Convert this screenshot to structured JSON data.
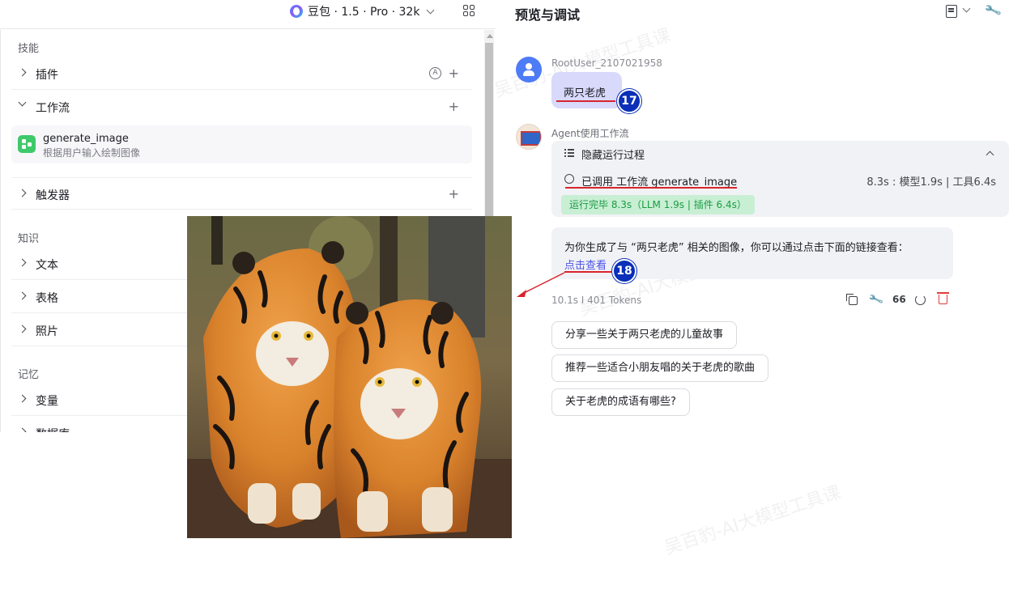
{
  "model_selector": {
    "label": "豆包 · 1.5 · Pro · 32k"
  },
  "left": {
    "skills_title": "技能",
    "plugin_label": "插件",
    "auto_badge": "A",
    "workflow_label": "工作流",
    "workflow_item": {
      "name": "generate_image",
      "desc": "根据用户输入绘制图像"
    },
    "trigger_label": "触发器",
    "knowledge_title": "知识",
    "text_label": "文本",
    "table_label": "表格",
    "photo_label": "照片",
    "memory_title": "记忆",
    "variable_label": "变量",
    "database_label": "数据库",
    "plus": "+"
  },
  "right": {
    "title": "预览与调试",
    "user_name": "RootUser_2107021958",
    "user_message": "两只老虎",
    "agent_name": "Agent使用工作流",
    "hide_process": "隐藏运行过程",
    "called_text": "已调用 工作流 generate_image",
    "timing": "8.3s : 模型1.9s | 工具6.4s",
    "done_badge": "运行完毕 8.3s（LLM 1.9s | 插件 6.4s）",
    "answer_text": "为你生成了与 “两只老虎” 相关的图像，你可以通过点击下面的链接查看：",
    "answer_link": "点击查看",
    "stats": "10.1s I 401 Tokens",
    "quote_icon": "66",
    "suggestions": [
      "分享一些关于两只老虎的儿童故事",
      "推荐一些适合小朋友唱的关于老虎的歌曲",
      "关于老虎的成语有哪些?"
    ]
  },
  "badges": {
    "b17": "17",
    "b18": "18"
  },
  "watermark": "吴百豹-AI大模型工具课",
  "colors": {
    "accent": "#4d53e8",
    "user_bubble": "#d8d9fb",
    "success": "#1b9a45",
    "danger": "#d9242d",
    "badge": "#0a2fb8"
  },
  "icons": [
    "doubao-logo-icon",
    "grid-icon",
    "chevron-right-icon",
    "chevron-down-icon",
    "plus-icon",
    "workflow-icon",
    "doc-settings-icon",
    "wrench-icon",
    "user-avatar-icon",
    "agent-avatar-icon",
    "list-icon",
    "copy-icon",
    "quote-icon",
    "refresh-icon",
    "trash-icon"
  ]
}
